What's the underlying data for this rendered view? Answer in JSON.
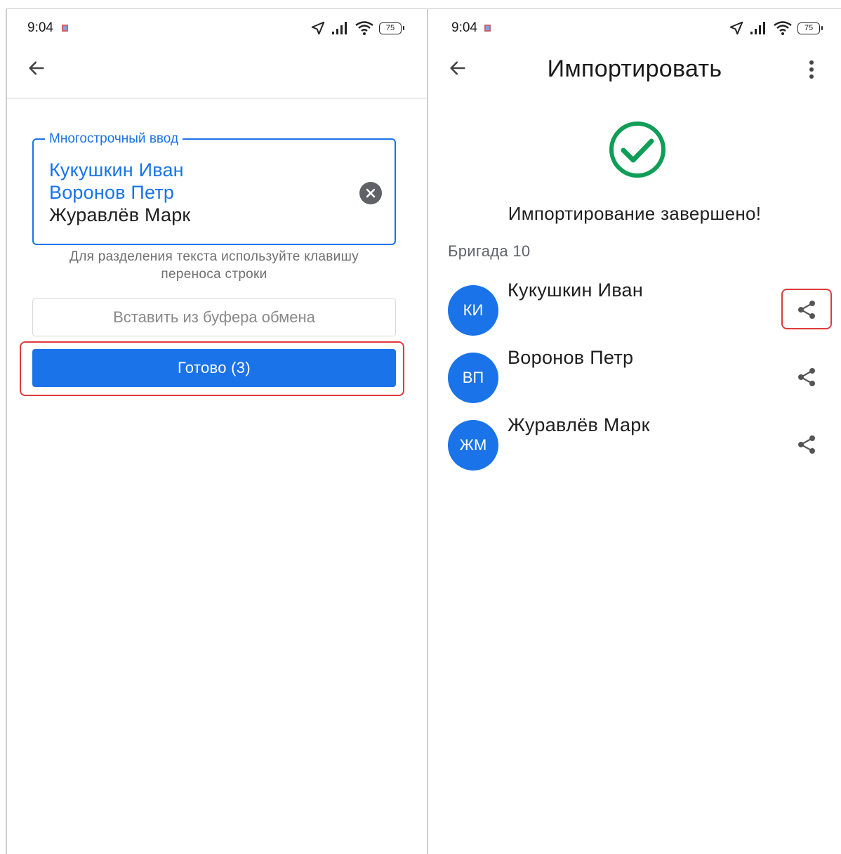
{
  "left_screen": {
    "status": {
      "time": "9:04",
      "battery": "75"
    },
    "field": {
      "label": "Многострочный ввод",
      "lines": [
        "Кукушкин Иван",
        "Воронов Петр",
        "Журавлёв Марк"
      ]
    },
    "helper_lines": [
      "Для разделения текста используйте клавишу",
      "переноса строки"
    ],
    "paste_button": "Вставить из буфера обмена",
    "done_button": "Готово (3)"
  },
  "right_screen": {
    "status": {
      "time": "9:04",
      "battery": "75"
    },
    "title": "Импортировать",
    "result_message": "Импортирование завершено!",
    "group_title": "Бригада 10",
    "contacts": [
      {
        "initials": "КИ",
        "name": "Кукушкин Иван"
      },
      {
        "initials": "ВП",
        "name": "Воронов Петр"
      },
      {
        "initials": "ЖМ",
        "name": "Журавлёв Марк"
      }
    ]
  },
  "colors": {
    "accent": "#1a73e8",
    "success": "#0f9d58",
    "highlight": "#e03a3a",
    "helper_text": "#6f6f6f"
  },
  "icons": {
    "back": "arrow-left-icon",
    "more": "more-vert-icon",
    "clear": "clear-circle-icon",
    "check": "check-circle-icon",
    "share": "share-icon",
    "location": "location-arrow-icon",
    "signal": "signal-icon",
    "wifi": "wifi-icon",
    "battery": "battery-icon"
  }
}
